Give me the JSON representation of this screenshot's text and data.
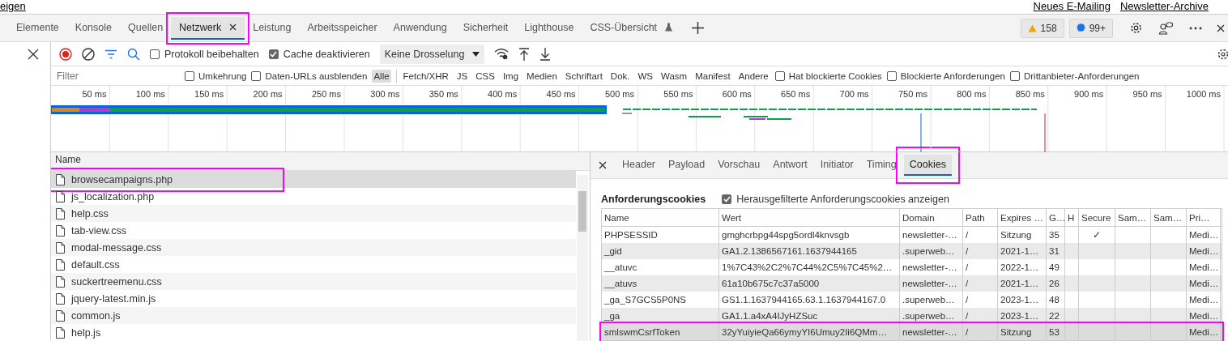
{
  "page_links": {
    "left": "eigen",
    "right": [
      "Neues E-Mailing",
      "Newsletter-Archive"
    ]
  },
  "devtools_tabs": [
    {
      "label": "Elemente",
      "selected": false,
      "closable": false,
      "experimental": false,
      "highlighted": false
    },
    {
      "label": "Konsole",
      "selected": false,
      "closable": false,
      "experimental": false,
      "highlighted": false
    },
    {
      "label": "Quellen",
      "selected": false,
      "closable": false,
      "experimental": false,
      "highlighted": false
    },
    {
      "label": "Netzwerk",
      "selected": true,
      "closable": true,
      "experimental": false,
      "highlighted": true
    },
    {
      "label": "Leistung",
      "selected": false,
      "closable": false,
      "experimental": false,
      "highlighted": false
    },
    {
      "label": "Arbeitsspeicher",
      "selected": false,
      "closable": false,
      "experimental": false,
      "highlighted": false
    },
    {
      "label": "Anwendung",
      "selected": false,
      "closable": false,
      "experimental": false,
      "highlighted": false
    },
    {
      "label": "Sicherheit",
      "selected": false,
      "closable": false,
      "experimental": false,
      "highlighted": false
    },
    {
      "label": "Lighthouse",
      "selected": false,
      "closable": false,
      "experimental": false,
      "highlighted": false
    },
    {
      "label": "CSS-Übersicht",
      "selected": false,
      "closable": false,
      "experimental": true,
      "highlighted": false
    }
  ],
  "issue_badges": [
    {
      "kind": "warning",
      "count": "158"
    },
    {
      "kind": "message",
      "count": "99+"
    }
  ],
  "toolbar": {
    "checkboxes": [
      {
        "label": "Protokoll beibehalten",
        "checked": false
      },
      {
        "label": "Cache deaktivieren",
        "checked": true
      }
    ],
    "throttling": "Keine Drosselung"
  },
  "filter_bar": {
    "placeholder": "Filter",
    "options": [
      {
        "label": "Umkehrung",
        "checked": false
      },
      {
        "label": "Daten-URLs ausblenden",
        "checked": false
      }
    ],
    "types": [
      {
        "label": "Alle",
        "selected": true
      },
      {
        "label": "Fetch/XHR",
        "selected": false
      },
      {
        "label": "JS",
        "selected": false
      },
      {
        "label": "CSS",
        "selected": false
      },
      {
        "label": "Img",
        "selected": false
      },
      {
        "label": "Medien",
        "selected": false
      },
      {
        "label": "Schriftart",
        "selected": false
      },
      {
        "label": "Dok.",
        "selected": false
      },
      {
        "label": "WS",
        "selected": false
      },
      {
        "label": "Wasm",
        "selected": false
      },
      {
        "label": "Manifest",
        "selected": false
      },
      {
        "label": "Andere",
        "selected": false
      }
    ],
    "extra_checkboxes": [
      {
        "label": "Hat blockierte Cookies",
        "checked": false
      },
      {
        "label": "Blockierte Anforderungen",
        "checked": false
      },
      {
        "label": "Drittanbieter-Anforderungen",
        "checked": false
      }
    ]
  },
  "timeline": {
    "ticks": [
      "50 ms",
      "100 ms",
      "150 ms",
      "200 ms",
      "250 ms",
      "300 ms",
      "350 ms",
      "400 ms",
      "450 ms",
      "500 ms",
      "550 ms",
      "600 ms",
      "650 ms",
      "700 ms",
      "750 ms",
      "800 ms",
      "850 ms",
      "900 ms",
      "950 ms",
      "1000 ms"
    ]
  },
  "requests": {
    "header": "Name",
    "rows": [
      {
        "name": "browsecampaigns.php",
        "selected": true,
        "highlighted": true
      },
      {
        "name": "js_localization.php",
        "selected": false,
        "highlighted": false
      },
      {
        "name": "help.css",
        "selected": false,
        "highlighted": false
      },
      {
        "name": "tab-view.css",
        "selected": false,
        "highlighted": false
      },
      {
        "name": "modal-message.css",
        "selected": false,
        "highlighted": false
      },
      {
        "name": "default.css",
        "selected": false,
        "highlighted": false
      },
      {
        "name": "suckertreemenu.css",
        "selected": false,
        "highlighted": false
      },
      {
        "name": "jquery-latest.min.js",
        "selected": false,
        "highlighted": false
      },
      {
        "name": "common.js",
        "selected": false,
        "highlighted": false
      },
      {
        "name": "help.js",
        "selected": false,
        "highlighted": false
      }
    ]
  },
  "details": {
    "tabs": [
      {
        "label": "Header",
        "selected": false,
        "highlighted": false
      },
      {
        "label": "Payload",
        "selected": false,
        "highlighted": false
      },
      {
        "label": "Vorschau",
        "selected": false,
        "highlighted": false
      },
      {
        "label": "Antwort",
        "selected": false,
        "highlighted": false
      },
      {
        "label": "Initiator",
        "selected": false,
        "highlighted": false
      },
      {
        "label": "Timing",
        "selected": false,
        "highlighted": false
      },
      {
        "label": "Cookies",
        "selected": true,
        "highlighted": true
      }
    ],
    "section_title": "Anforderungscookies",
    "show_filtered": {
      "label": "Herausgefilterte Anforderungscookies anzeigen",
      "checked": true
    },
    "columns": [
      "Name",
      "Wert",
      "Domain",
      "Path",
      "Expires …",
      "G…",
      "H",
      "Secure",
      "Sam…",
      "Sam…",
      "Pri…"
    ],
    "rows": [
      {
        "cells": [
          "PHPSESSID",
          "gmghcrbpg44spg5ordl4knvsgb",
          "newsletter-…",
          "/",
          "Sitzung",
          "35",
          "",
          "✓",
          "",
          "",
          "Medi…"
        ],
        "selected": false,
        "highlighted": false
      },
      {
        "cells": [
          "_gid",
          "GA1.2.1386567161.1637944165",
          ".superweb…",
          "/",
          "2021-1…",
          "31",
          "",
          "",
          "",
          "",
          "Medi…"
        ],
        "selected": false,
        "highlighted": false
      },
      {
        "cells": [
          "__atuvc",
          "1%7C43%2C2%7C44%2C5%7C45%2…",
          "newsletter-…",
          "/",
          "2022-1…",
          "49",
          "",
          "",
          "",
          "",
          "Medi…"
        ],
        "selected": false,
        "highlighted": false
      },
      {
        "cells": [
          "__atuvs",
          "61a10b675c7c37a5000",
          "newsletter-…",
          "/",
          "2021-1…",
          "26",
          "",
          "",
          "",
          "",
          "Medi…"
        ],
        "selected": false,
        "highlighted": false
      },
      {
        "cells": [
          "_ga_S7GCS5P0NS",
          "GS1.1.1637944165.63.1.1637944167.0",
          ".superweb…",
          "/",
          "2023-1…",
          "48",
          "",
          "",
          "",
          "",
          "Medi…"
        ],
        "selected": false,
        "highlighted": false
      },
      {
        "cells": [
          "_ga",
          "GA1.1.a4xA4IJyHZSuc",
          ".superweb…",
          "/",
          "2023-1…",
          "22",
          "",
          "",
          "",
          "",
          "Medi…"
        ],
        "selected": false,
        "highlighted": false
      },
      {
        "cells": [
          "smlswmCsrfToken",
          "32yYuiyieQa66ymyYI6Umuy2Ii6QMm…",
          "newsletter-…",
          "/",
          "Sitzung",
          "53",
          "",
          "",
          "",
          "",
          "Medi…"
        ],
        "selected": true,
        "highlighted": true
      }
    ]
  }
}
